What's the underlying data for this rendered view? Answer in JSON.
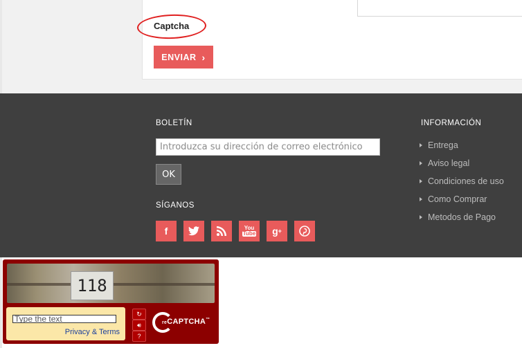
{
  "form": {
    "captcha_label": "Captcha",
    "send_label": "ENVIAR",
    "send_icon": "chevron-right-icon"
  },
  "footer": {
    "newsletter": {
      "title": "BOLETÍN",
      "placeholder": "Introduzca su dirección de correo electrónico",
      "ok_label": "OK"
    },
    "follow": {
      "title": "SÍGANOS",
      "icons": [
        "facebook-icon",
        "twitter-icon",
        "rss-icon",
        "youtube-icon",
        "google-plus-icon",
        "pinterest-icon"
      ]
    },
    "info": {
      "title": "INFORMACIÓN",
      "items": [
        "Entrega",
        "Aviso legal",
        "Condiciones de uso",
        "Como Comprar",
        "Metodos de Pago"
      ]
    }
  },
  "recaptcha": {
    "image_text": "118",
    "input_placeholder": "Type the text",
    "privacy_label": "Privacy & Terms",
    "logo_text": "CAPTCHA",
    "logo_prefix": "re",
    "logo_tm": "™"
  },
  "colors": {
    "accent": "#e85b5b",
    "footer_bg": "#3f3f3f",
    "recaptcha_bg": "#8c0000"
  }
}
